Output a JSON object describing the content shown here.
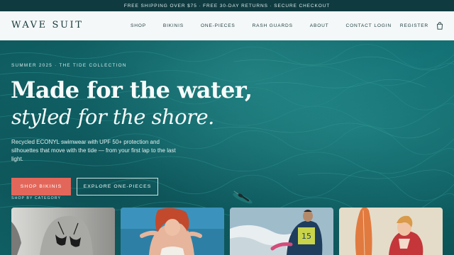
{
  "promo": {
    "text": "FREE SHIPPING OVER $75 · FREE 30-DAY RETURNS · SECURE CHECKOUT"
  },
  "brand": {
    "name": "WAVE SUIT"
  },
  "nav": {
    "items": [
      {
        "label": "SHOP"
      },
      {
        "label": "BIKINIS"
      },
      {
        "label": "ONE-PIECES"
      },
      {
        "label": "RASH GUARDS"
      },
      {
        "label": "ABOUT"
      },
      {
        "label": "CONTACT"
      }
    ],
    "login": "LOGIN",
    "register": "REGISTER",
    "cart_icon": "shopping-bag-icon"
  },
  "hero": {
    "eyebrow": "SUMMER 2025 · THE TIDE COLLECTION",
    "headline_line1": "Made for the water,",
    "headline_line2": "styled for the shore.",
    "description": "Recycled ECONYL swimwear with UPF 50+ protection and silhouettes that move with the tide — from your first lap to the last light.",
    "primary_cta": "SHOP BIKINIS",
    "secondary_cta": "EXPLORE ONE-PIECES",
    "category_label": "SHOP BY CATEGORY"
  },
  "colors": {
    "ocean": "#127074",
    "promo_bar": "#0f3b40",
    "nav_bg": "#f4f8f8",
    "accent_coral": "#e2675a"
  }
}
